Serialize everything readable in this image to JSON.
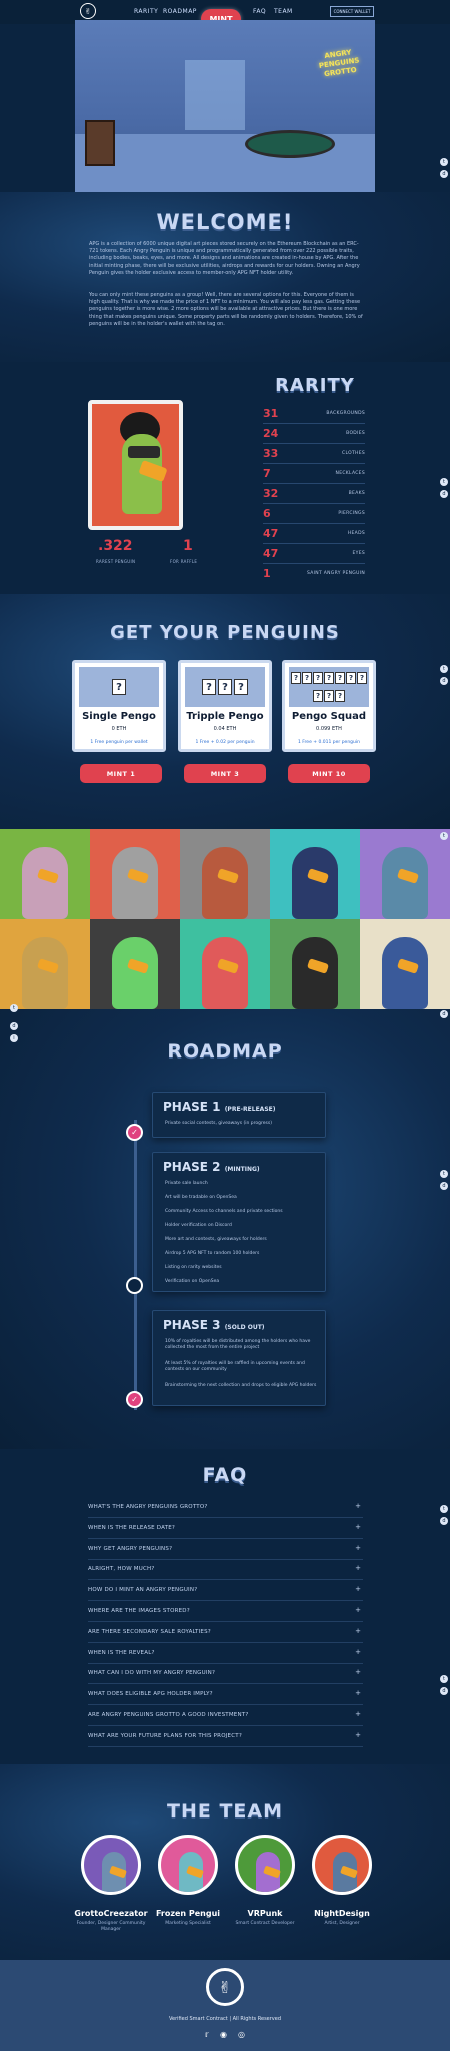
{
  "nav": {
    "links": [
      "RARITY",
      "ROADMAP",
      "MINT",
      "FAQ",
      "TEAM"
    ],
    "connect": "CONNECT WALLET"
  },
  "hero": {
    "sign": "ANGRY PENGUINS GROTTO"
  },
  "welcome": {
    "title": "WELCOME!",
    "p1": "APG is a collection of 6000 unique digital art pieces stored securely on the Ethereum Blockchain as an ERC-721 tokens. Each Angry Penguin is unique and programmatically generated from over 222 possible traits, including bodies, beaks, eyes, and more. All designs and animations are created in-house by APG. After the initial minting phase, there will be exclusive utilities, airdrops and rewards for our holders. Owning an Angry Penguin gives the holder exclusive access to member-only APG NFT holder utility.",
    "p2": "You can only mint these penguins as a group! Well, there are several options for this. Everyone of them is high quality. That is why we made the price of 1 NFT to a minimum. You will also pay less gas. Getting these penguins together is more wise. 2 more options will be available at attractive prices. But there is one more thing that makes penguins unique. Some property parts will be randomly given to holders. Therefore, 10% of penguins will be in the holder's wallet with the tag on."
  },
  "rarity": {
    "title": "RARITY",
    "big1": ".322",
    "big1_label": "RAREST PENGUIN",
    "big2": "1",
    "big2_label": "FOR RAFFLE",
    "rows": [
      {
        "n": "31",
        "l": "BACKGROUNDS"
      },
      {
        "n": "24",
        "l": "BODIES"
      },
      {
        "n": "33",
        "l": "CLOTHES"
      },
      {
        "n": "7",
        "l": "NECKLACES"
      },
      {
        "n": "32",
        "l": "BEAKS"
      },
      {
        "n": "6",
        "l": "PIERCINGS"
      },
      {
        "n": "47",
        "l": "HEADS"
      },
      {
        "n": "47",
        "l": "EYES"
      },
      {
        "n": "1",
        "l": "SAINT ANGRY PENGUIN"
      }
    ]
  },
  "mint": {
    "title": "GET YOUR PENGUINS",
    "cards": [
      {
        "title": "Single Pengo",
        "price": "0 ETH",
        "desc": "1 Free penguin per wallet",
        "button": "MINT 1"
      },
      {
        "title": "Tripple Pengo",
        "price": "0.04 ETH",
        "desc": "1 Free + 0.02 per penguin",
        "button": "MINT 3"
      },
      {
        "title": "Pengo Squad",
        "price": "0.099 ETH",
        "desc": "1 Free + 0.011 per penguin",
        "button": "MINT 10"
      }
    ]
  },
  "roadmap": {
    "title": "ROADMAP",
    "phases": [
      {
        "title": "PHASE 1",
        "sub": "(PRE-RELEASE)",
        "items": [
          "Private social contests, giveaways (in progress)"
        ]
      },
      {
        "title": "PHASE 2",
        "sub": "(MINTING)",
        "items": [
          "Private sale launch",
          "Art will be tradable on OpenSea",
          "Community Access to channels and private sections",
          "Holder verification on Discord",
          "More art and contests, giveaways for holders",
          "Airdrop 5 APG NFT to random 100 holders",
          "Listing on rarity websites",
          "Verification on OpenSea"
        ]
      },
      {
        "title": "PHASE 3",
        "sub": "(SOLD OUT)",
        "items": [
          "10% of royalties will be distributed among the holders who have collected the most from the entire project",
          "At least 5% of royalties will be raffled in upcoming events and contests on our community",
          "Brainstorming the next collection and drops to eligible APG holders"
        ]
      }
    ]
  },
  "faq": {
    "title": "FAQ",
    "items": [
      "WHAT'S THE ANGRY PENGUINS GROTTO?",
      "WHEN IS THE RELEASE DATE?",
      "WHY GET ANGRY PENGUINS?",
      "ALRIGHT, HOW MUCH?",
      "HOW DO I MINT AN ANGRY PENGUIN?",
      "WHERE ARE THE IMAGES STORED?",
      "ARE THERE SECONDARY SALE ROYALTIES?",
      "WHEN IS THE REVEAL?",
      "WHAT CAN I DO WITH MY ANGRY PENGUIN?",
      "WHAT DOES ELIGIBLE APG HOLDER IMPLY?",
      "ARE ANGRY PENGUINS GROTTO A GOOD INVESTMENT?",
      "WHAT ARE YOUR FUTURE PLANS FOR THIS PROJECT?"
    ]
  },
  "team": {
    "title": "THE TEAM",
    "members": [
      {
        "name": "GrottoCreezator",
        "role": "Founder, Designer Community Manager"
      },
      {
        "name": "Frozen Pengui",
        "role": "Marketing Specialist"
      },
      {
        "name": "VRPunk",
        "role": "Smart Contract Developer"
      },
      {
        "name": "NightDesign",
        "role": "Artist, Designer"
      }
    ]
  },
  "footer": {
    "text": "Verified Smart Contract | All Rights Reserved"
  }
}
